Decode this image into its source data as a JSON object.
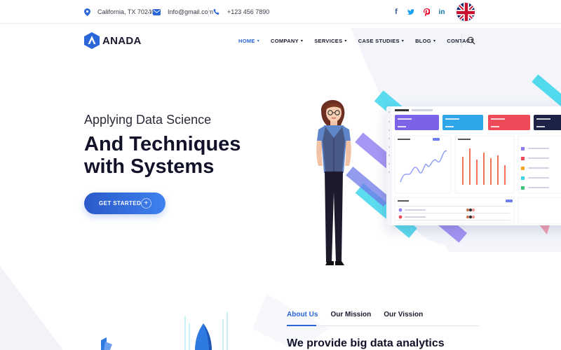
{
  "topbar": {
    "location": "California, TX 70240",
    "email": "Info@gmail.com",
    "phone": "+123 456 7890",
    "social": [
      {
        "name": "facebook-icon",
        "glyph": "f",
        "color": "#3b5998"
      },
      {
        "name": "twitter-icon",
        "glyph": "t",
        "color": "#1da1f2"
      },
      {
        "name": "pinterest-icon",
        "glyph": "p",
        "color": "#e60023"
      },
      {
        "name": "linkedin-icon",
        "glyph": "in",
        "color": "#0e76a8"
      }
    ],
    "language_flag": "uk-flag-icon"
  },
  "nav": {
    "logo_text": "ANADA",
    "items": [
      {
        "label": "HOME",
        "has_dropdown": true,
        "active": true
      },
      {
        "label": "COMPANY",
        "has_dropdown": true
      },
      {
        "label": "SERVICES",
        "has_dropdown": true
      },
      {
        "label": "CASE STUDIES",
        "has_dropdown": true
      },
      {
        "label": "BLOG",
        "has_dropdown": true
      },
      {
        "label": "CONTACT",
        "has_dropdown": false
      }
    ],
    "search_icon": "search-icon"
  },
  "hero": {
    "subtitle": "Applying Data Science",
    "title_line1": "And Techniques",
    "title_line2": "with Systems",
    "cta_label": "GET STARTED",
    "cta_icon": "plus-icon"
  },
  "about": {
    "tabs": [
      "About Us",
      "Our Mission",
      "Our Vission"
    ],
    "active_tab": "About Us",
    "heading": "We provide big data analytics"
  },
  "colors": {
    "accent": "#2b66d9",
    "dark": "#12122a",
    "cyan": "#3fd6ec",
    "violet": "#8f7df0"
  }
}
